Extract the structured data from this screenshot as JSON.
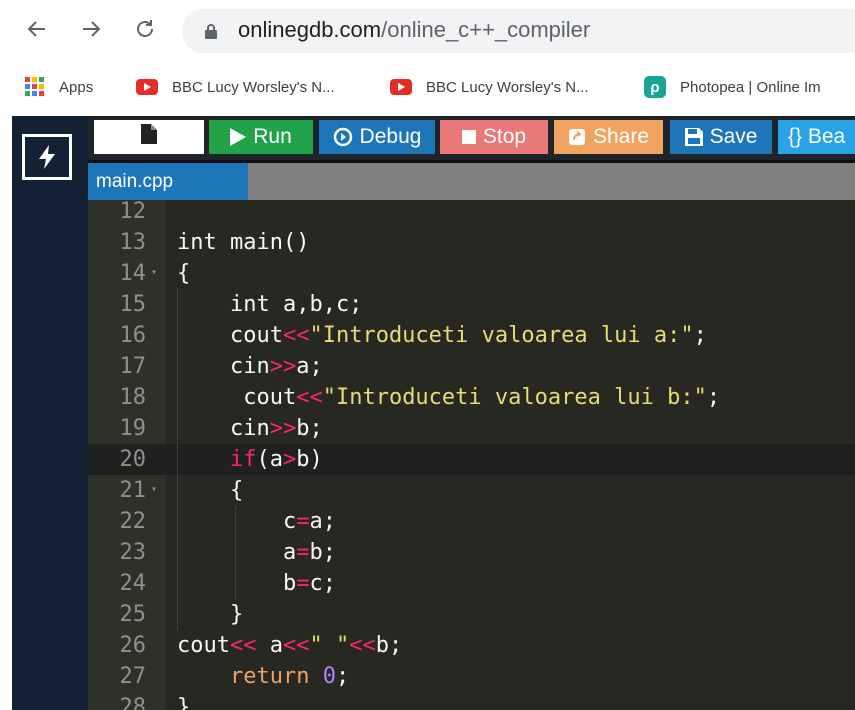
{
  "browser": {
    "url_domain": "onlinegdb.com",
    "url_path": "/online_c++_compiler",
    "bookmarks": [
      {
        "label": "Apps",
        "icon": "apps-grid-icon"
      },
      {
        "label": "BBC Lucy Worsley's N...",
        "icon": "youtube-icon"
      },
      {
        "label": "BBC Lucy Worsley's N...",
        "icon": "youtube-icon"
      },
      {
        "label": "Photopea | Online Im",
        "icon": "photopea-icon"
      }
    ]
  },
  "toolbar": {
    "run": "Run",
    "debug": "Debug",
    "stop": "Stop",
    "share": "Share",
    "save": "Save",
    "beautify": "{} Bea"
  },
  "tab": {
    "name": "main.cpp"
  },
  "editor": {
    "active_line": 20,
    "lines": [
      {
        "n": "12",
        "fold": false,
        "tokens": []
      },
      {
        "n": "13",
        "fold": false,
        "tokens": [
          {
            "t": "int main()",
            "c": "plain"
          }
        ]
      },
      {
        "n": "14",
        "fold": true,
        "tokens": [
          {
            "t": "{",
            "c": "plain"
          }
        ]
      },
      {
        "n": "15",
        "fold": false,
        "tokens": [
          {
            "t": "    int a,b,c;",
            "c": "plain"
          }
        ]
      },
      {
        "n": "16",
        "fold": false,
        "tokens": [
          {
            "t": "    cout",
            "c": "plain"
          },
          {
            "t": "<<",
            "c": "op"
          },
          {
            "t": "\"Introduceti valoarea lui a:\"",
            "c": "str"
          },
          {
            "t": ";",
            "c": "plain"
          }
        ]
      },
      {
        "n": "17",
        "fold": false,
        "tokens": [
          {
            "t": "    cin",
            "c": "plain"
          },
          {
            "t": ">>",
            "c": "op"
          },
          {
            "t": "a;",
            "c": "plain"
          }
        ]
      },
      {
        "n": "18",
        "fold": false,
        "tokens": [
          {
            "t": "     cout",
            "c": "plain"
          },
          {
            "t": "<<",
            "c": "op"
          },
          {
            "t": "\"Introduceti valoarea lui b:\"",
            "c": "str"
          },
          {
            "t": ";",
            "c": "plain"
          }
        ]
      },
      {
        "n": "19",
        "fold": false,
        "tokens": [
          {
            "t": "    cin",
            "c": "plain"
          },
          {
            "t": ">>",
            "c": "op"
          },
          {
            "t": "b;",
            "c": "plain"
          }
        ]
      },
      {
        "n": "20",
        "fold": false,
        "tokens": [
          {
            "t": "    ",
            "c": "plain"
          },
          {
            "t": "if",
            "c": "kw"
          },
          {
            "t": "(a",
            "c": "plain"
          },
          {
            "t": ">",
            "c": "op"
          },
          {
            "t": "b)",
            "c": "plain"
          }
        ]
      },
      {
        "n": "21",
        "fold": true,
        "tokens": [
          {
            "t": "    {",
            "c": "plain"
          }
        ]
      },
      {
        "n": "22",
        "fold": false,
        "tokens": [
          {
            "t": "        c",
            "c": "plain"
          },
          {
            "t": "=",
            "c": "op"
          },
          {
            "t": "a;",
            "c": "plain"
          }
        ]
      },
      {
        "n": "23",
        "fold": false,
        "tokens": [
          {
            "t": "        a",
            "c": "plain"
          },
          {
            "t": "=",
            "c": "op"
          },
          {
            "t": "b;",
            "c": "plain"
          }
        ]
      },
      {
        "n": "24",
        "fold": false,
        "tokens": [
          {
            "t": "        b",
            "c": "plain"
          },
          {
            "t": "=",
            "c": "op"
          },
          {
            "t": "c;",
            "c": "plain"
          }
        ]
      },
      {
        "n": "25",
        "fold": false,
        "tokens": [
          {
            "t": "    }",
            "c": "plain"
          }
        ]
      },
      {
        "n": "26",
        "fold": false,
        "tokens": [
          {
            "t": "cout",
            "c": "plain"
          },
          {
            "t": "<<",
            "c": "op"
          },
          {
            "t": " a",
            "c": "plain"
          },
          {
            "t": "<<",
            "c": "op"
          },
          {
            "t": "\" \"",
            "c": "str"
          },
          {
            "t": "<<",
            "c": "op"
          },
          {
            "t": "b;",
            "c": "plain"
          }
        ]
      },
      {
        "n": "27",
        "fold": false,
        "tokens": [
          {
            "t": "    ",
            "c": "plain"
          },
          {
            "t": "return",
            "c": "ret"
          },
          {
            "t": " ",
            "c": "plain"
          },
          {
            "t": "0",
            "c": "num"
          },
          {
            "t": ";",
            "c": "plain"
          }
        ]
      },
      {
        "n": "28",
        "fold": false,
        "tokens": [
          {
            "t": "}",
            "c": "plain"
          }
        ]
      }
    ]
  }
}
